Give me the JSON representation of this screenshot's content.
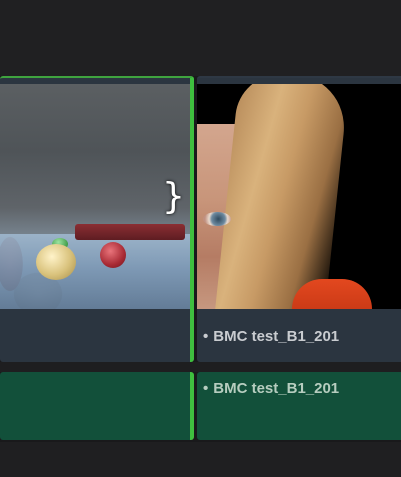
{
  "timeline": {
    "video_track": {
      "clips": [
        {
          "label": ""
        },
        {
          "label": "BMC test_B1_201",
          "bullet": "•"
        }
      ],
      "edit_marker_glyph": "}"
    },
    "audio_track": {
      "clips": [
        {
          "label": ""
        },
        {
          "label": "BMC test_B1_201",
          "bullet": "•"
        }
      ]
    }
  },
  "colors": {
    "selection_outline": "#3fbf3f",
    "video_clip_bg": "#2b3540",
    "audio_clip_bg": "#12503a"
  }
}
